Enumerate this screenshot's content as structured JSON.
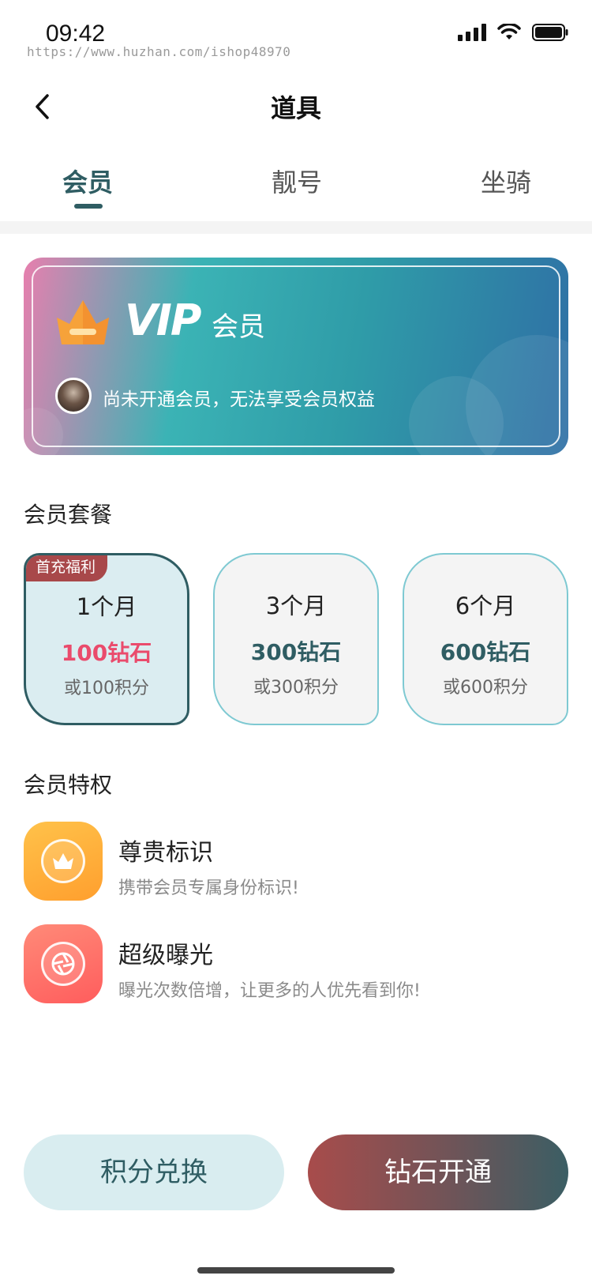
{
  "status_bar": {
    "time": "09:42",
    "watermark": "https://www.huzhan.com/ishop48970",
    "icons": [
      "signal-icon",
      "wifi-icon",
      "battery-icon"
    ]
  },
  "nav": {
    "back_icon": "chevron-left-icon",
    "title": "道具"
  },
  "tabs": [
    {
      "label": "会员",
      "active": true
    },
    {
      "label": "靓号",
      "active": false
    },
    {
      "label": "坐骑",
      "active": false
    }
  ],
  "vip_card": {
    "logo_text": "VIP",
    "suffix": "会员",
    "status_text": "尚未开通会员，无法享受会员权益",
    "crown_icon": "crown-icon"
  },
  "plans_section": {
    "title": "会员套餐",
    "plans": [
      {
        "badge": "首充福利",
        "name": "1个月",
        "price": "100钻石",
        "alt": "或100积分",
        "selected": true
      },
      {
        "name": "3个月",
        "price": "300钻石",
        "alt": "或300积分",
        "selected": false
      },
      {
        "name": "6个月",
        "price": "600钻石",
        "alt": "或600积分",
        "selected": false
      }
    ]
  },
  "privileges_section": {
    "title": "会员特权",
    "items": [
      {
        "icon": "crown-badge-icon",
        "title": "尊贵标识",
        "desc": "携带会员专属身份标识!"
      },
      {
        "icon": "camera-shutter-icon",
        "title": "超级曝光",
        "desc": "曝光次数倍增，让更多的人优先看到你!"
      }
    ]
  },
  "buttons": {
    "points": "积分兑换",
    "diamond": "钻石开通"
  },
  "colors": {
    "accent": "#2f5d63",
    "price_highlight": "#ea4b6c",
    "badge": "#a8484a"
  }
}
